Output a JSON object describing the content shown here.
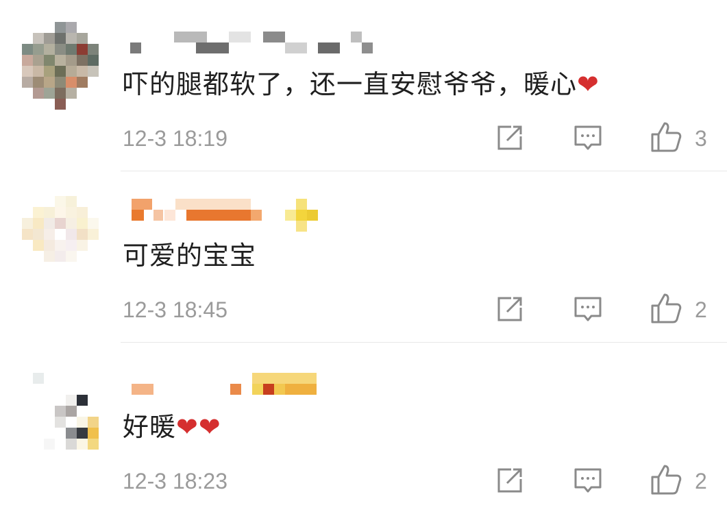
{
  "comments": [
    {
      "text": "吓的腿都软了，还一直安慰爷爷，暖心",
      "hearts": "❤",
      "time": "12-3 18:19",
      "likes": "3",
      "icons": [
        "share-icon",
        "reply-icon",
        "like-icon"
      ]
    },
    {
      "text": "可爱的宝宝",
      "hearts": "",
      "time": "12-3 18:45",
      "likes": "2",
      "icons": [
        "share-icon",
        "reply-icon",
        "like-icon"
      ]
    },
    {
      "text": "好暖",
      "hearts": "❤❤",
      "time": "12-3 18:23",
      "likes": "2",
      "icons": [
        "share-icon",
        "reply-icon",
        "like-icon"
      ]
    }
  ],
  "colors": {
    "text": "#1f1f1f",
    "meta": "#9a9a9a",
    "heart": "#d52f2f",
    "divider": "#e7e7e7"
  }
}
